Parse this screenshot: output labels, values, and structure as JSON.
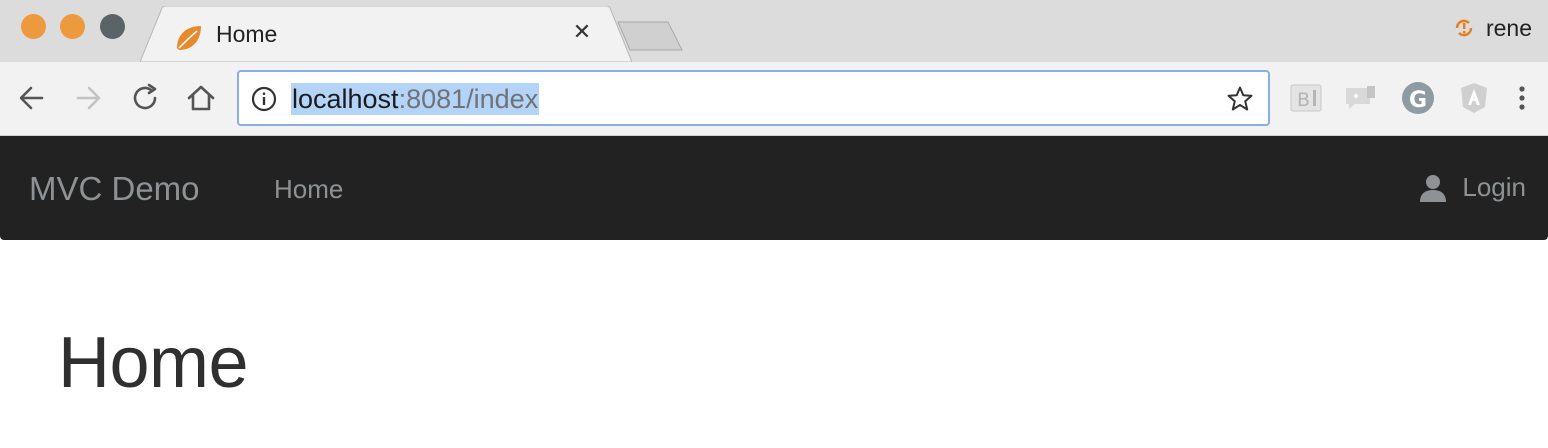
{
  "browser": {
    "tab": {
      "title": "Home",
      "favicon": "spring-leaf-icon"
    },
    "profile": {
      "name": "rene",
      "icon": "sync-error-icon"
    },
    "address_bar": {
      "host": "localhost",
      "rest": ":8081/index",
      "selected": true
    },
    "extensions": [
      "bootstrap-extension-icon",
      "chat-extension-icon",
      "grammarly-extension-icon",
      "angular-extension-icon"
    ],
    "colors": {
      "traffic_close": "#ed9a3f",
      "traffic_min": "#ed9a3f",
      "traffic_max": "#5a6366",
      "selection": "#b3d3f7"
    }
  },
  "navbar": {
    "brand": "MVC Demo",
    "links": [
      {
        "label": "Home"
      }
    ],
    "login_label": "Login",
    "background": "#222222"
  },
  "main": {
    "heading": "Home"
  }
}
